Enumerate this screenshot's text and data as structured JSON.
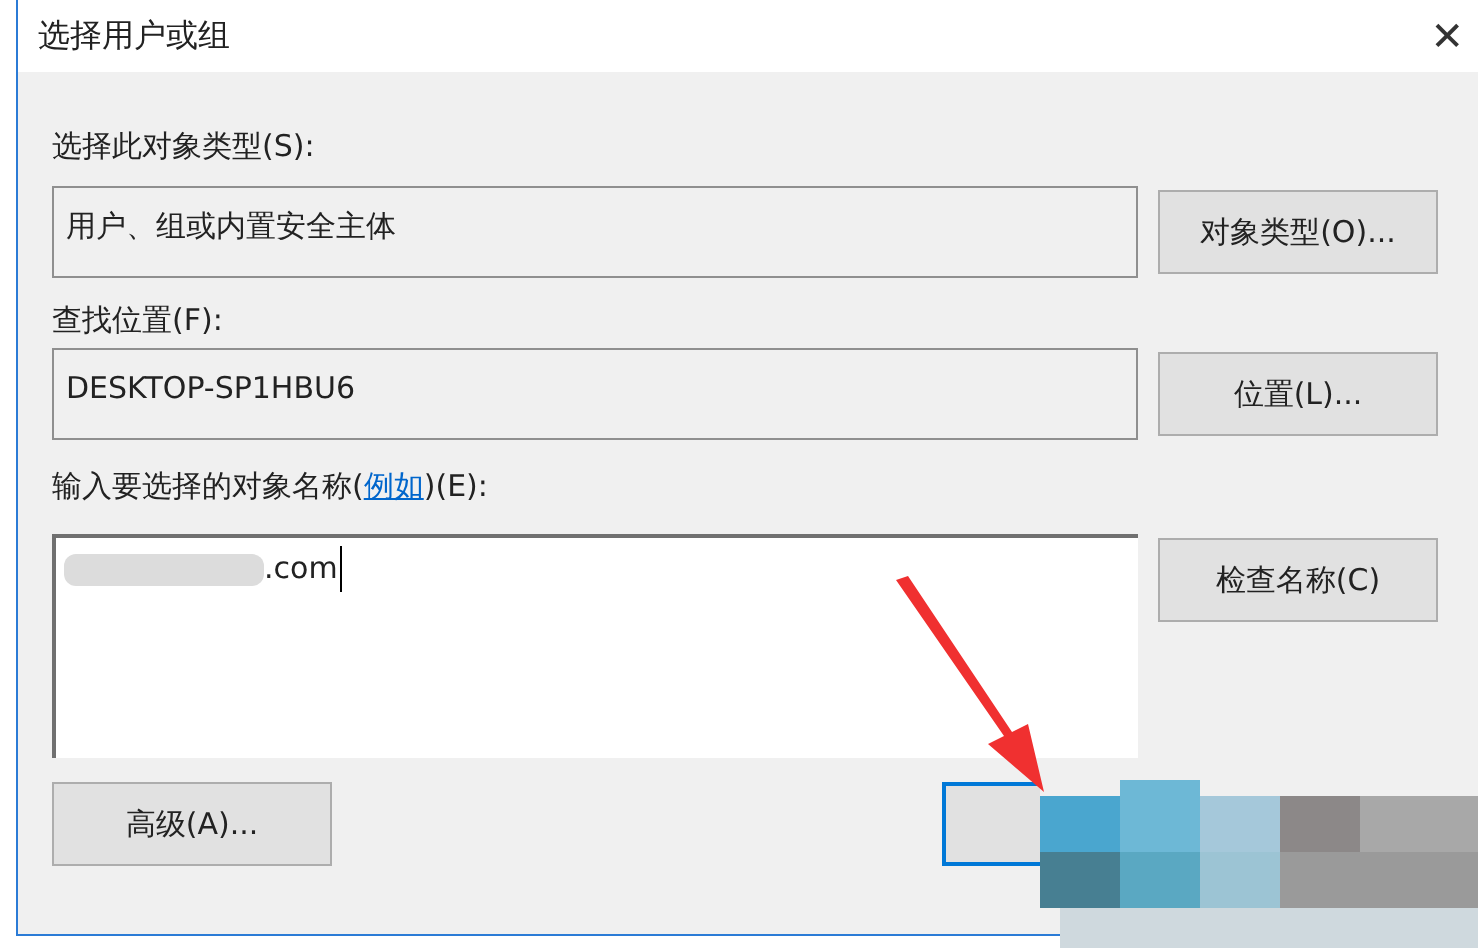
{
  "window": {
    "title": "选择用户或组",
    "close": "✕"
  },
  "object_type": {
    "label": "选择此对象类型(S):",
    "value": "用户、组或内置安全主体",
    "button": "对象类型(O)..."
  },
  "location": {
    "label": "查找位置(F):",
    "value": "DESKTOP-SP1HBU6",
    "button": "位置(L)..."
  },
  "names": {
    "label_before": "输入要选择的对象名称(",
    "link": "例如",
    "label_after": ")(E):",
    "value": ".com",
    "button": "检查名称(C)"
  },
  "buttons": [
    {
      "kind": "advanced",
      "label": "高级(A)..."
    },
    {
      "kind": "default"
    }
  ]
}
